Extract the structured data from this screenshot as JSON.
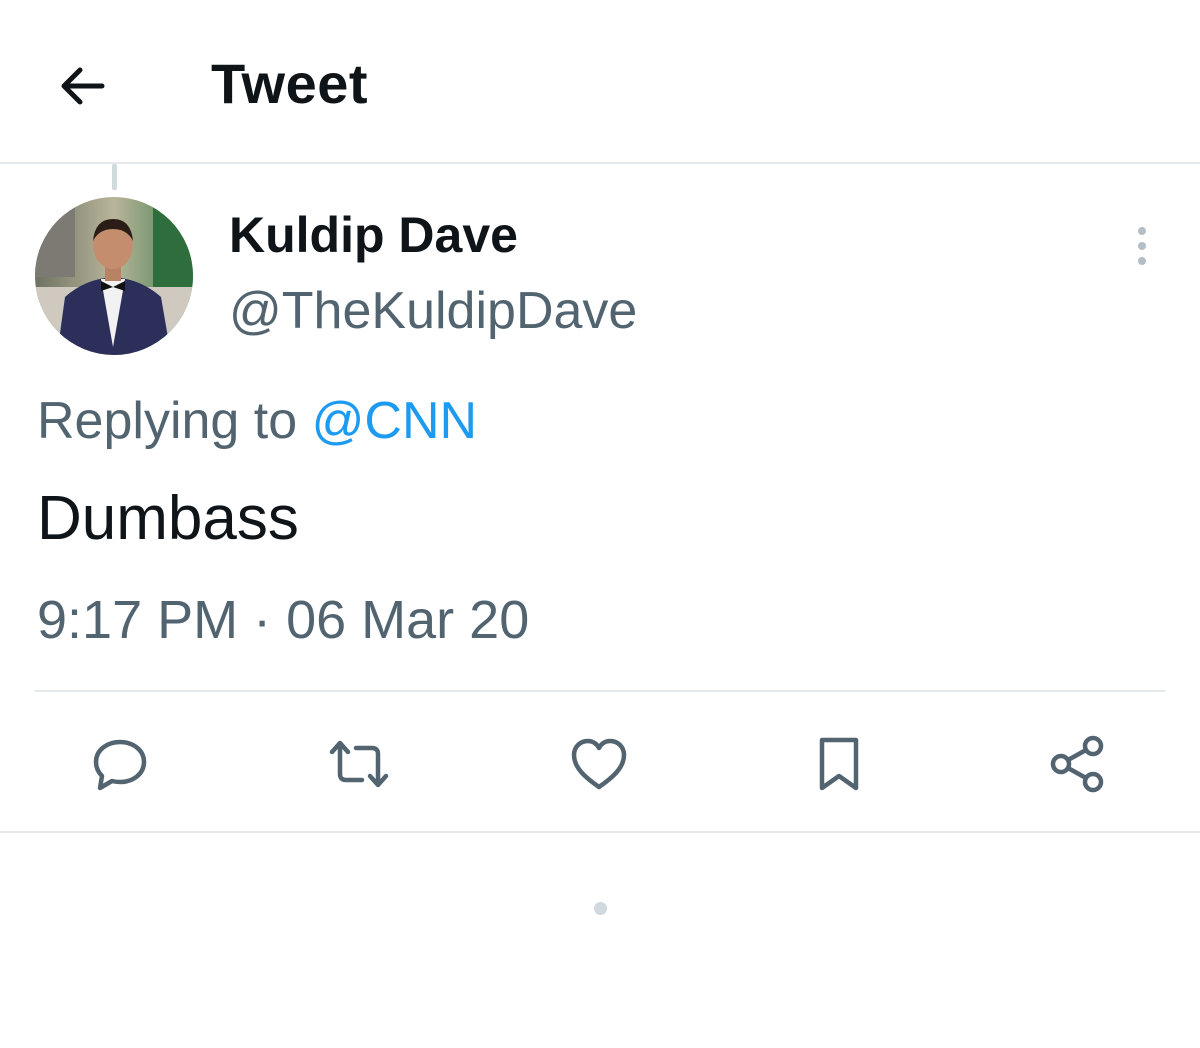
{
  "header": {
    "title": "Tweet",
    "back_icon": "arrow-left-icon"
  },
  "tweet": {
    "author": {
      "display_name": "Kuldip Dave",
      "handle": "@TheKuldipDave"
    },
    "replying_to_prefix": "Replying to ",
    "replying_to_mention": "@CNN",
    "text": "Dumbass",
    "timestamp": "9:17 PM · 06 Mar 20"
  },
  "actions": [
    {
      "name": "reply",
      "icon": "reply-bubble-icon"
    },
    {
      "name": "retweet",
      "icon": "retweet-icon"
    },
    {
      "name": "like",
      "icon": "heart-icon"
    },
    {
      "name": "bookmark",
      "icon": "bookmark-icon"
    },
    {
      "name": "share",
      "icon": "share-icon"
    }
  ],
  "colors": {
    "text": "#0f1419",
    "secondary": "#536471",
    "accent": "#1d9bf0",
    "divider": "#e6e9ec"
  }
}
